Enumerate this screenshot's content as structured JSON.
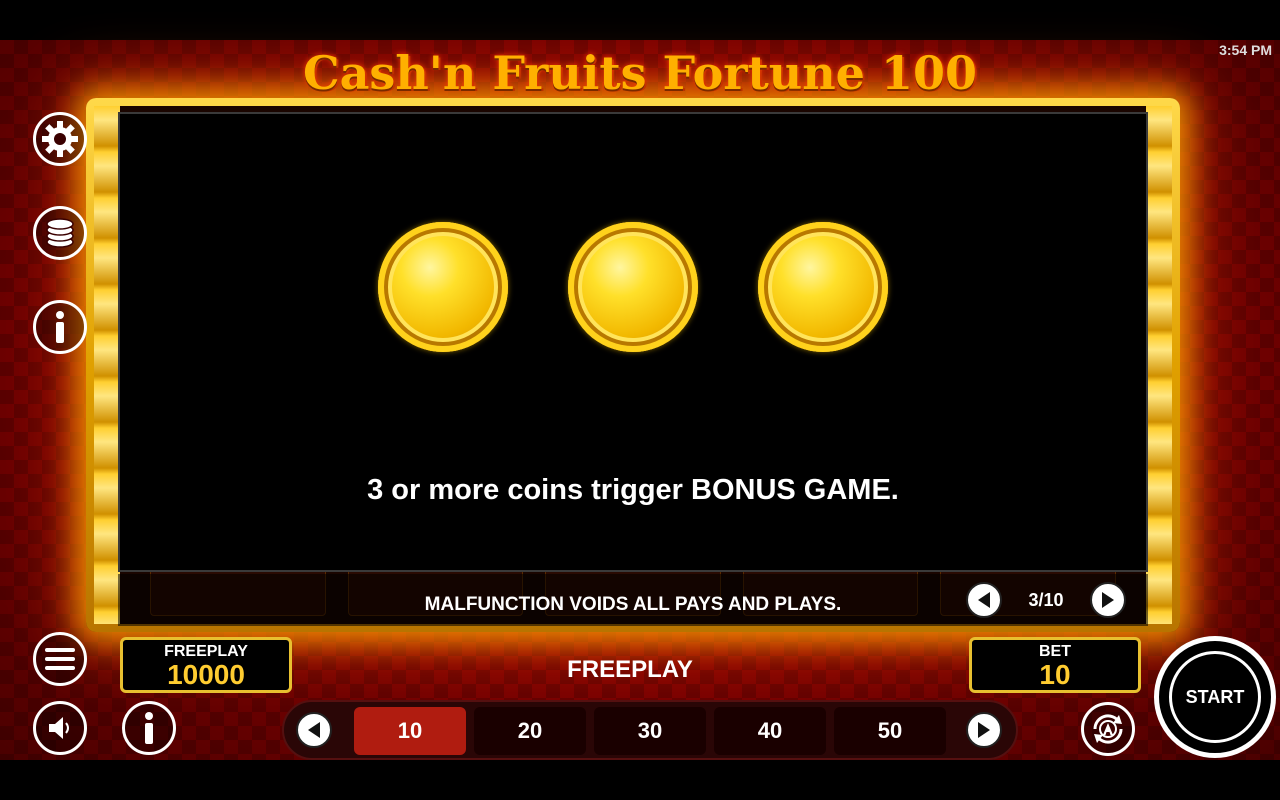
{
  "status": {
    "time": "3:54 PM"
  },
  "game": {
    "title": "Cash'n Fruits Fortune 100"
  },
  "side_menu": {
    "icons": [
      "gear-icon",
      "coins-stack-icon",
      "info-icon"
    ]
  },
  "help": {
    "text": "3 or more coins trigger BONUS GAME.",
    "footer": "MALFUNCTION VOIDS ALL PAYS AND PLAYS.",
    "page": "3/10"
  },
  "bottom": {
    "balance_label": "FREEPLAY",
    "balance_value": "10000",
    "mode_label": "FREEPLAY",
    "bet_label": "BET",
    "bet_value": "10",
    "bet_options": [
      "10",
      "20",
      "30",
      "40",
      "50"
    ],
    "selected_bet": "10",
    "start_label": "START"
  },
  "colors": {
    "gold": "#ffcc30",
    "selected_bet": "#b01c10",
    "background_red": "#8a0000"
  }
}
